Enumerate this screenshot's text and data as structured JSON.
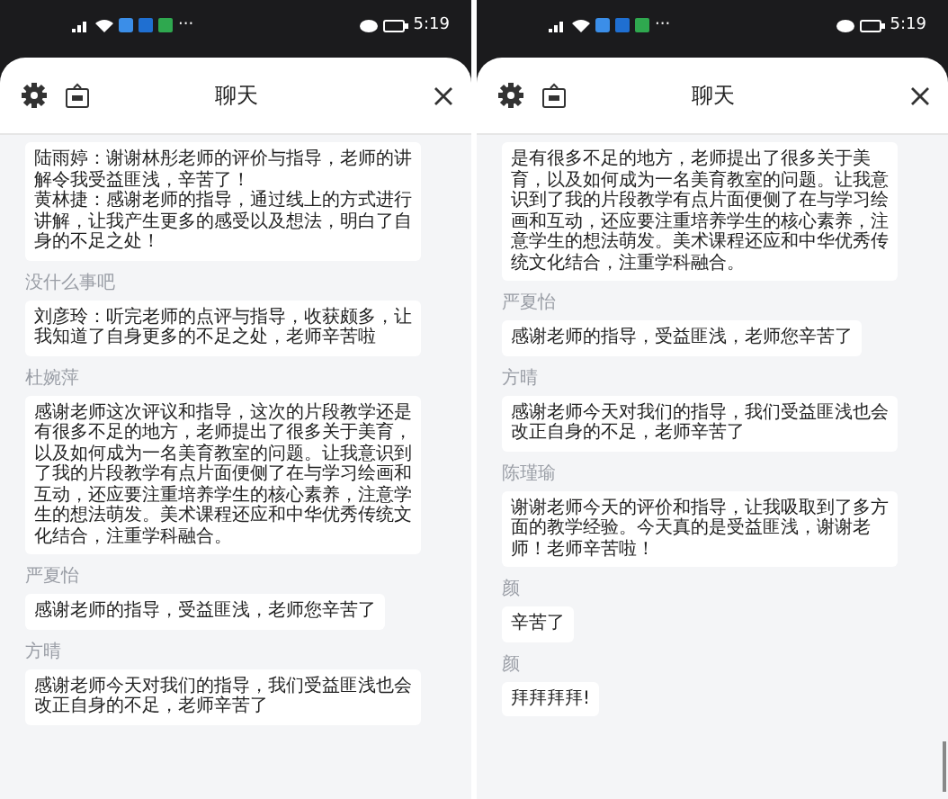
{
  "screens": [
    {
      "status_bar": {
        "more": "···",
        "time": "5:19"
      },
      "header": {
        "title": "聊天"
      },
      "scrollbar": false,
      "messages": [
        {
          "text": "陆雨婷：谢谢林彤老师的评价与指导，老师的讲解令我受益匪浅，辛苦了！",
          "text_2": "黄林捷：感谢老师的指导，通过线上的方式进行讲解，让我产生更多的感受以及想法，明白了自身的不足之处！"
        },
        {
          "sender": "没什么事吧",
          "text": "刘彦玲：听完老师的点评与指导，收获颇多，让我知道了自身更多的不足之处，老师辛苦啦"
        },
        {
          "sender": "杜婉萍",
          "text": "感谢老师这次评议和指导，这次的片段教学还是有很多不足的地方，老师提出了很多关于美育，以及如何成为一名美育教室的问题。让我意识到了我的片段教学有点片面便侧了在与学习绘画和互动，还应要注重培养学生的核心素养，注意学生的想法萌发。美术课程还应和中华优秀传统文化结合，注重学科融合。"
        },
        {
          "sender": "严夏怡",
          "text": "感谢老师的指导，受益匪浅，老师您辛苦了"
        },
        {
          "sender": "方晴",
          "text": "感谢老师今天对我们的指导，我们受益匪浅也会改正自身的不足，老师辛苦了"
        }
      ]
    },
    {
      "status_bar": {
        "more": "···",
        "time": "5:19"
      },
      "header": {
        "title": "聊天"
      },
      "scrollbar": true,
      "messages": [
        {
          "text": "是有很多不足的地方，老师提出了很多关于美育，以及如何成为一名美育教室的问题。让我意识到了我的片段教学有点片面便侧了在与学习绘画和互动，还应要注重培养学生的核心素养，注意学生的想法萌发。美术课程还应和中华优秀传统文化结合，注重学科融合。"
        },
        {
          "sender": "严夏怡",
          "text": "感谢老师的指导，受益匪浅，老师您辛苦了"
        },
        {
          "sender": "方晴",
          "text": "感谢老师今天对我们的指导，我们受益匪浅也会改正自身的不足，老师辛苦了"
        },
        {
          "sender": "陈瑾瑜",
          "text": "谢谢老师今天的评价和指导，让我吸取到了多方面的教学经验。今天真的是受益匪浅，谢谢老师！老师辛苦啦！"
        },
        {
          "sender": "颜",
          "text": "辛苦了"
        },
        {
          "sender": "颜",
          "text": "拜拜拜拜!"
        }
      ]
    }
  ]
}
